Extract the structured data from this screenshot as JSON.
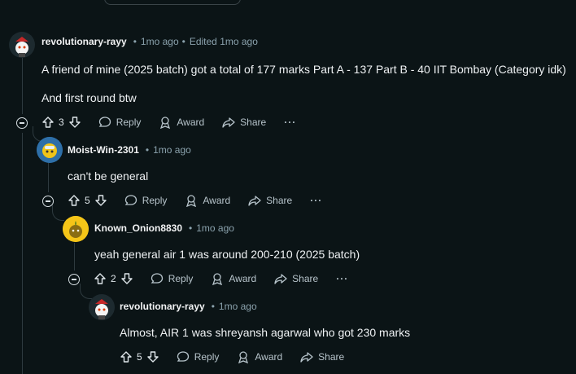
{
  "comments": [
    {
      "author": "revolutionary-rayy",
      "time": "1mo ago",
      "edited": "Edited 1mo ago",
      "body_line1": "A friend of mine (2025 batch) got a total of 177 marks Part A - 137 Part B - 40 IIT Bombay (Category idk)",
      "body_line2": "And first round btw",
      "votes": "3"
    },
    {
      "author": "Moist-Win-2301",
      "time": "1mo ago",
      "body_line1": "can't be general",
      "votes": "5"
    },
    {
      "author": "Known_Onion8830",
      "time": "1mo ago",
      "body_line1": "yeah general air 1 was around 200-210 (2025 batch)",
      "votes": "2"
    },
    {
      "author": "revolutionary-rayy",
      "time": "1mo ago",
      "body_line1": "Almost, AIR 1 was shreyansh agarwal who got 230 marks",
      "votes": "5"
    }
  ],
  "actions": {
    "reply": "Reply",
    "award": "Award",
    "share": "Share",
    "more": "···",
    "separator": "•"
  }
}
